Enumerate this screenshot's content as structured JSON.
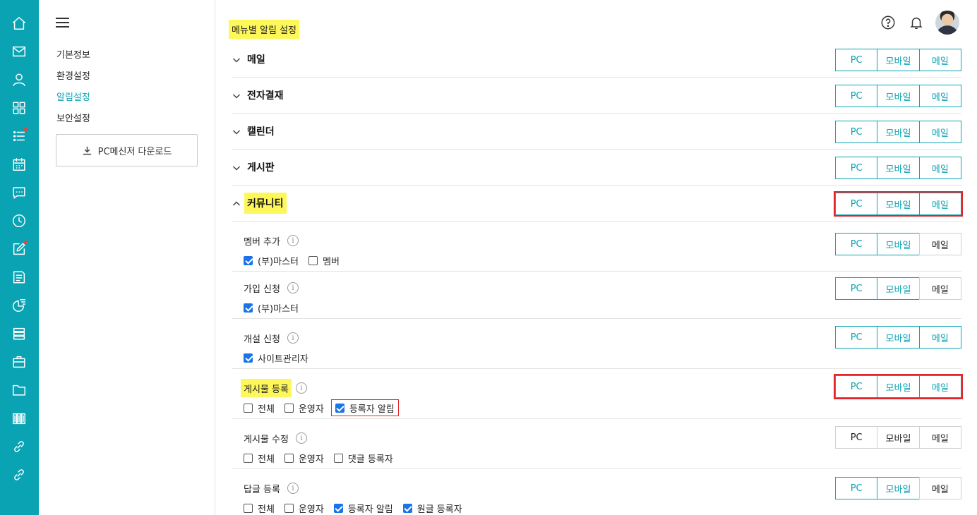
{
  "rail": {
    "items": [
      {
        "icon": "home-icon"
      },
      {
        "icon": "mail-icon"
      },
      {
        "icon": "user-icon"
      },
      {
        "icon": "grid-icon"
      },
      {
        "icon": "list-icon",
        "badge": true
      },
      {
        "icon": "calendar-icon"
      },
      {
        "icon": "chat-icon"
      },
      {
        "icon": "clock-icon"
      },
      {
        "icon": "edit-icon",
        "badge": true
      },
      {
        "icon": "board-icon"
      },
      {
        "icon": "report-chart-icon"
      },
      {
        "icon": "storage-icon"
      },
      {
        "icon": "briefcase-icon"
      },
      {
        "icon": "folder-icon"
      },
      {
        "icon": "building-icon"
      },
      {
        "icon": "link-icon"
      },
      {
        "icon": "link-icon"
      }
    ]
  },
  "sidebar": {
    "menu": [
      {
        "label": "기본정보",
        "active": false
      },
      {
        "label": "환경설정",
        "active": false
      },
      {
        "label": "알림설정",
        "active": true
      },
      {
        "label": "보안설정",
        "active": false
      }
    ],
    "download_label": "PC메신저 다운로드"
  },
  "header": {
    "title": "메뉴별 알림 설정",
    "help_icon": "help-icon",
    "bell_icon": "bell-icon"
  },
  "toggle_labels": {
    "pc": "PC",
    "mobile": "모바일",
    "mail": "메일"
  },
  "categories": [
    {
      "label": "메일",
      "expanded": false
    },
    {
      "label": "전자결재",
      "expanded": false
    },
    {
      "label": "캘린더",
      "expanded": false
    },
    {
      "label": "게시판",
      "expanded": false
    },
    {
      "label": "커뮤니티",
      "expanded": true
    }
  ],
  "community_items": [
    {
      "title": "멤버 추가",
      "options": [
        {
          "label": "(부)마스터",
          "checked": true
        },
        {
          "label": "멤버",
          "checked": false
        }
      ],
      "toggles": {
        "pc": true,
        "mobile": true,
        "mail": false
      }
    },
    {
      "title": "가입 신청",
      "options": [
        {
          "label": "(부)마스터",
          "checked": true
        }
      ],
      "toggles": {
        "pc": true,
        "mobile": true,
        "mail": false
      }
    },
    {
      "title": "개설 신청",
      "options": [
        {
          "label": "사이트관리자",
          "checked": true
        }
      ],
      "toggles": {
        "pc": true,
        "mobile": true,
        "mail": true
      }
    },
    {
      "title": "게시물 등록",
      "options": [
        {
          "label": "전체",
          "checked": false
        },
        {
          "label": "운영자",
          "checked": false
        },
        {
          "label": "등록자 알림",
          "checked": true
        }
      ],
      "toggles": {
        "pc": true,
        "mobile": true,
        "mail": true
      }
    },
    {
      "title": "게시물 수정",
      "options": [
        {
          "label": "전체",
          "checked": false
        },
        {
          "label": "운영자",
          "checked": false
        },
        {
          "label": "댓글 등록자",
          "checked": false
        }
      ],
      "toggles": {
        "pc": false,
        "mobile": false,
        "mail": false
      }
    },
    {
      "title": "답글 등록",
      "options": [
        {
          "label": "전체",
          "checked": false
        },
        {
          "label": "운영자",
          "checked": false
        },
        {
          "label": "등록자 알림",
          "checked": true
        },
        {
          "label": "원글 등록자",
          "checked": true
        }
      ],
      "toggles": {
        "pc": true,
        "mobile": true,
        "mail": false
      }
    }
  ],
  "colors": {
    "accent": "#0aa3b3",
    "highlight": "#fdf75a",
    "alert_box": "#e0262b",
    "checkbox": "#1a73e8"
  }
}
